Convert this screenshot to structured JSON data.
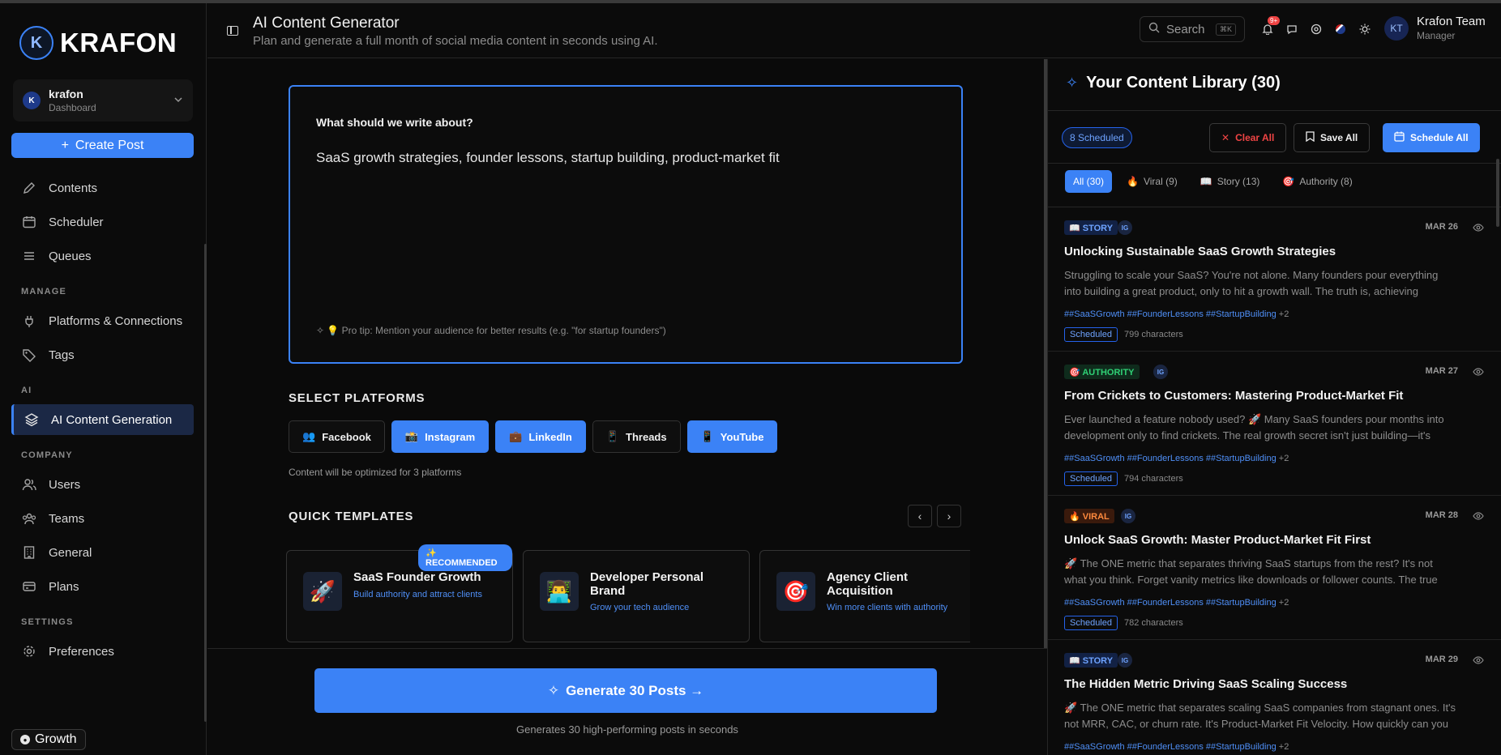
{
  "brand": {
    "name": "KRAFON",
    "mark": "K"
  },
  "workspace": {
    "avatar": "K",
    "name": "krafon",
    "sub": "Dashboard"
  },
  "sidebar": {
    "create_label": "Create Post",
    "items_top": [
      {
        "label": "Contents",
        "icon": "pencil-icon"
      },
      {
        "label": "Scheduler",
        "icon": "calendar-icon"
      },
      {
        "label": "Queues",
        "icon": "list-icon"
      }
    ],
    "sections": {
      "manage": "MANAGE",
      "ai": "AI",
      "company": "COMPANY",
      "settings": "SETTINGS"
    },
    "items_manage": [
      {
        "label": "Platforms & Connections",
        "icon": "plug-icon"
      },
      {
        "label": "Tags",
        "icon": "tag-icon"
      }
    ],
    "items_ai": [
      {
        "label": "AI Content Generation",
        "icon": "layers-icon"
      }
    ],
    "items_company": [
      {
        "label": "Users",
        "icon": "users-icon"
      },
      {
        "label": "Teams",
        "icon": "teams-icon"
      },
      {
        "label": "General",
        "icon": "building-icon"
      },
      {
        "label": "Plans",
        "icon": "card-icon"
      }
    ],
    "items_settings": [
      {
        "label": "Preferences",
        "icon": "gear-icon"
      }
    ],
    "plan_badge": "Growth"
  },
  "header": {
    "title": "AI Content Generator",
    "subtitle": "Plan and generate a full month of social media content in seconds using AI.",
    "search_placeholder": "Search",
    "search_kbd": "⌘K",
    "notif_badge": "9+",
    "user": {
      "initials": "KT",
      "name": "Krafon Team",
      "role": "Manager"
    }
  },
  "prompt": {
    "label": "What should we write about?",
    "value": "SaaS growth strategies, founder lessons, startup building, product-market fit",
    "tip": "💡 Pro tip: Mention your audience for better results (e.g. \"for startup founders\")"
  },
  "platforms": {
    "title": "SELECT PLATFORMS",
    "items": [
      {
        "label": "Facebook",
        "emoji": "👥",
        "selected": false
      },
      {
        "label": "Instagram",
        "emoji": "📸",
        "selected": true
      },
      {
        "label": "LinkedIn",
        "emoji": "💼",
        "selected": true
      },
      {
        "label": "Threads",
        "emoji": "📱",
        "selected": false
      },
      {
        "label": "YouTube",
        "emoji": "📱",
        "selected": true
      }
    ],
    "note": "Content will be optimized for 3 platforms"
  },
  "templates": {
    "title": "QUICK TEMPLATES",
    "items": [
      {
        "title": "SaaS Founder Growth",
        "sub": "Build authority and attract clients",
        "emoji": "🚀",
        "badge": "✨ RECOMMENDED"
      },
      {
        "title": "Developer Personal Brand",
        "sub": "Grow your tech audience",
        "emoji": "👨‍💻"
      },
      {
        "title": "Agency Client Acquisition",
        "sub": "Win more clients with authority",
        "emoji": "🎯"
      }
    ]
  },
  "generate": {
    "label": "Generate 30 Posts →",
    "note": "Generates 30 high-performing posts in seconds"
  },
  "library": {
    "title": "Your Content Library (30)",
    "scheduled_pill": "8 Scheduled",
    "clear_label": "Clear All",
    "save_label": "Save All",
    "schedule_label": "Schedule All",
    "filters": [
      {
        "label": "All (30)",
        "emoji": "",
        "active": true
      },
      {
        "label": "Viral (9)",
        "emoji": "🔥",
        "active": false
      },
      {
        "label": "Story (13)",
        "emoji": "📖",
        "active": false
      },
      {
        "label": "Authority (8)",
        "emoji": "🎯",
        "active": false
      }
    ],
    "posts": [
      {
        "type": "story",
        "tag": "📖 STORY",
        "platform": "IG",
        "date": "MAR 26",
        "title": "Unlocking Sustainable SaaS Growth Strategies",
        "body": "Struggling to scale your SaaS? You're not alone. Many founders pour everything into building a great product, only to hit a growth wall. The truth is, achieving sustainable growth requires more.",
        "hashtags": "##SaaSGrowth ##FounderLessons ##StartupBuilding",
        "more": "+2",
        "status": "Scheduled",
        "chars": "799 characters"
      },
      {
        "type": "auth",
        "tag": "🎯 AUTHORITY",
        "platform": "IG",
        "date": "MAR 27",
        "title": "From Crickets to Customers: Mastering Product-Market Fit",
        "body": "Ever launched a feature nobody used? 🚀 Many SaaS founders pour months into development only to find crickets. The real growth secret isn't just building—it's building the right thing.",
        "hashtags": "##SaaSGrowth ##FounderLessons ##StartupBuilding",
        "more": "+2",
        "status": "Scheduled",
        "chars": "794 characters"
      },
      {
        "type": "viral",
        "tag": "🔥 VIRAL",
        "platform": "IG",
        "date": "MAR 28",
        "title": "Unlock SaaS Growth: Master Product-Market Fit First",
        "body": "🚀 The ONE metric that separates thriving SaaS startups from the rest? It's not what you think. Forget vanity metrics like downloads or follower counts. The true north star is product-market fit.",
        "hashtags": "##SaaSGrowth ##FounderLessons ##StartupBuilding",
        "more": "+2",
        "status": "Scheduled",
        "chars": "782 characters"
      },
      {
        "type": "story",
        "tag": "📖 STORY",
        "platform": "IG",
        "date": "MAR 29",
        "title": "The Hidden Metric Driving SaaS Scaling Success",
        "body": "🚀 The ONE metric that separates scaling SaaS companies from stagnant ones. It's not MRR, CAC, or churn rate. It's Product-Market Fit Velocity. How quickly can you iterate toward fit?",
        "hashtags": "##SaaSGrowth ##FounderLessons ##StartupBuilding",
        "more": "+2",
        "status": "",
        "chars": ""
      }
    ]
  },
  "colors": {
    "accent": "#3b82f6",
    "bg": "#0a0a0a",
    "danger": "#ef4444",
    "success": "#2fd075",
    "viral": "#ff8a3d"
  }
}
